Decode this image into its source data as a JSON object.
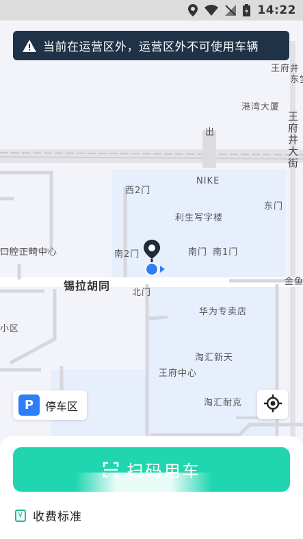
{
  "status_bar": {
    "time": "14:22",
    "icons": [
      "location-icon",
      "wifi-icon",
      "no-signal-icon",
      "battery-icon"
    ]
  },
  "warning": {
    "text": "当前在运营区外，运营区外不可使用车辆",
    "icon": "warning-icon"
  },
  "map": {
    "labels": {
      "wangfujing_top": "王府井",
      "wangfujing_top2": "东堂",
      "gangwan": "港湾大厦",
      "chu": "出",
      "wangfujing_street": "王府井大街",
      "nike": "NIKE",
      "xi2men": "西2门",
      "dongmen": "东门",
      "lisheng": "利生写字楼",
      "nan2men": "南2门",
      "nanmen": "南门",
      "nan1men": "南1门",
      "dental": "口腔正畸中心",
      "xila": "锡拉胡同",
      "beimen": "北门",
      "jinyu": "金鱼",
      "huawei": "华为专卖店",
      "xiaoqu": "小区",
      "taohui": "淘汇新天",
      "wangfu_center": "王府中心",
      "taohui_naike": "淘汇耐克"
    }
  },
  "parking": {
    "icon_letter": "P",
    "label": "停车区"
  },
  "scan": {
    "label": "扫码用车"
  },
  "fee": {
    "label": "收费标准"
  },
  "colors": {
    "accent": "#1fd6b1",
    "warning_bg": "#1f3247",
    "parking_blue": "#2d7ef7",
    "location_blue": "#2d7ef7"
  }
}
